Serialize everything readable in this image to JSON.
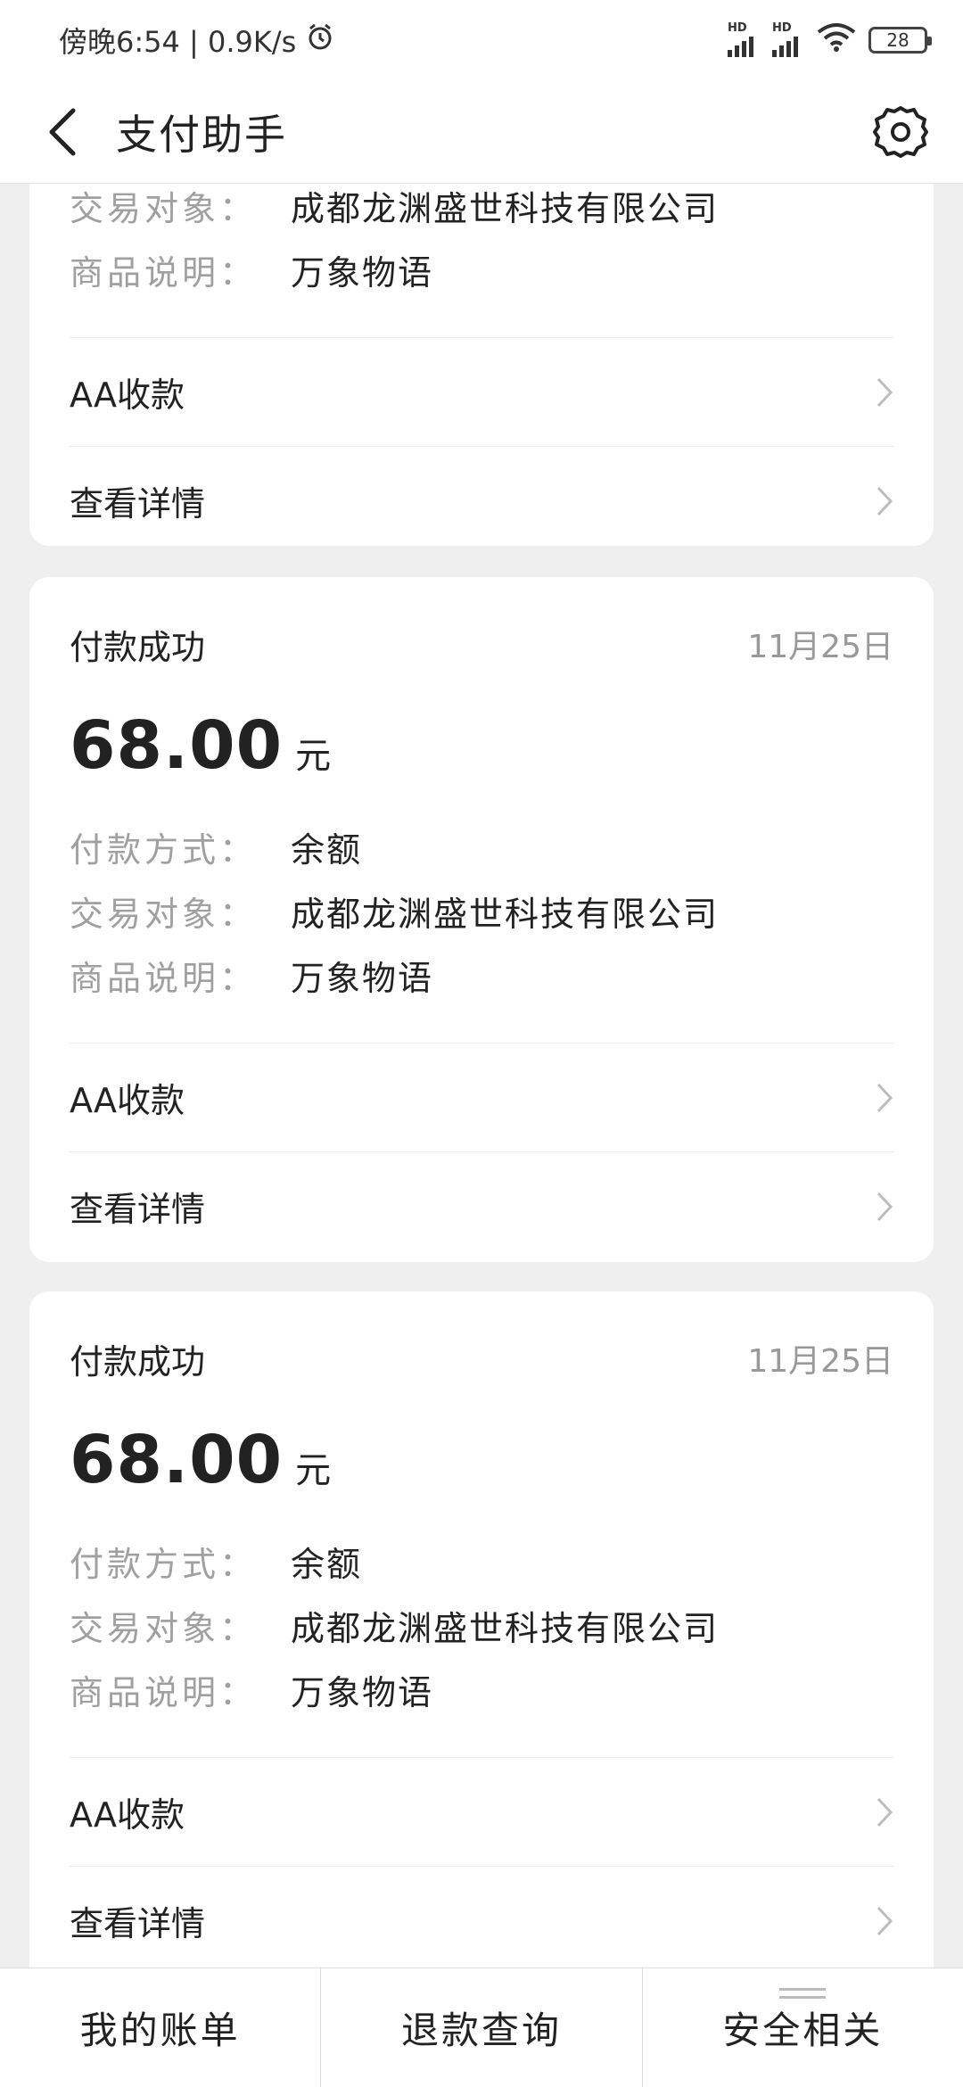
{
  "status_bar": {
    "time_speed": "傍晚6:54 | 0.9K/s",
    "signal_label": "HD",
    "battery": "28"
  },
  "header": {
    "title": "支付助手"
  },
  "labels": {
    "method": "付款方式：",
    "counterparty": "交易对象：",
    "description": "商品说明：",
    "unit": "元",
    "aa": "AA收款",
    "details": "查看详情"
  },
  "partial_card": {
    "counterparty": "成都龙渊盛世科技有限公司",
    "description": "万象物语"
  },
  "cards": [
    {
      "status": "付款成功",
      "date": "11月25日",
      "amount": "68.00",
      "method": "余额",
      "counterparty": "成都龙渊盛世科技有限公司",
      "description": "万象物语"
    },
    {
      "status": "付款成功",
      "date": "11月25日",
      "amount": "68.00",
      "method": "余额",
      "counterparty": "成都龙渊盛世科技有限公司",
      "description": "万象物语"
    }
  ],
  "bottom_nav": {
    "bills": "我的账单",
    "refund": "退款查询",
    "security": "安全相关"
  },
  "colors": {
    "background": "#efefef",
    "card": "#ffffff",
    "label_gray": "#a0a0a0",
    "date_gray": "#999999"
  },
  "icons": [
    "back-arrow-icon",
    "gear-icon",
    "chevron-right-icon",
    "alarm-icon",
    "wifi-icon",
    "menu-lines-icon"
  ]
}
